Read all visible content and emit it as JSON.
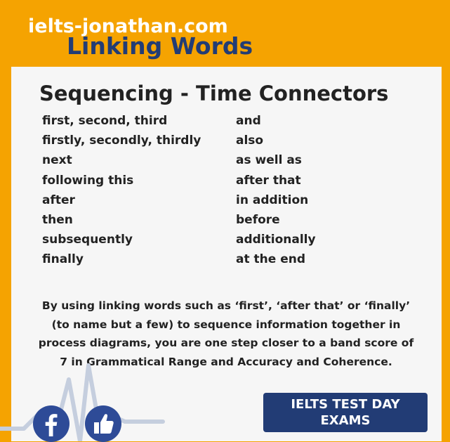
{
  "header": {
    "site": "ielts-jonathan.com",
    "title": "Linking Words"
  },
  "card": {
    "heading": "Sequencing - Time Connectors",
    "left_column": [
      "first, second, third",
      "firstly, secondly, thirdly",
      "next",
      "following this",
      "after",
      "then",
      "subsequently",
      "finally"
    ],
    "right_column": [
      "and",
      "also",
      "as well as",
      "after that",
      "in addition",
      "before",
      "additionally",
      "at the end"
    ],
    "paragraph": "By using linking words such as ‘first’, ‘after that’ or ‘finally’ (to name but a few) to sequence information together in process diagrams, you are one step closer to a band score of 7 in Grammatical Range and Accuracy and Coherence."
  },
  "footer": {
    "cta_label": "IELTS TEST DAY EXAMS",
    "icons": [
      "facebook-icon",
      "thumbs-up-icon",
      "pulse-line-decoration"
    ]
  },
  "colors": {
    "background": "#f5a301",
    "card": "#f6f6f6",
    "navy": "#223c75",
    "icon_blue": "#2e4b97",
    "text": "#222222"
  }
}
